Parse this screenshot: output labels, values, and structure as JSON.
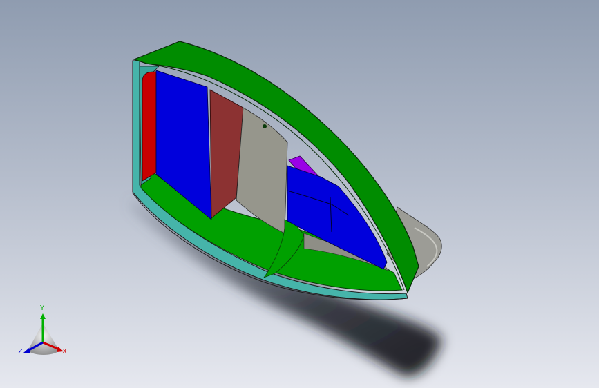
{
  "viewport": {
    "background_top": "#8f9cb0",
    "background_bottom": "#e6e8ef"
  },
  "model": {
    "name": "",
    "part_colors": {
      "hull_green": "#008c00",
      "inner_green": "#00a000",
      "shell_teal": "#46b4aa",
      "panel_blue": "#0000dc",
      "panel_red": "#c80000",
      "bulkhead_brown": "#8c3232",
      "grey_wall": "#96968c",
      "purple_part": "#9a00e6",
      "tail_grey": "#9c9c96"
    }
  },
  "triad": {
    "axes": {
      "x": {
        "label": "X",
        "color": "#d00000"
      },
      "y": {
        "label": "Y",
        "color": "#00b000"
      },
      "z": {
        "label": "Z",
        "color": "#0000d0"
      }
    }
  }
}
